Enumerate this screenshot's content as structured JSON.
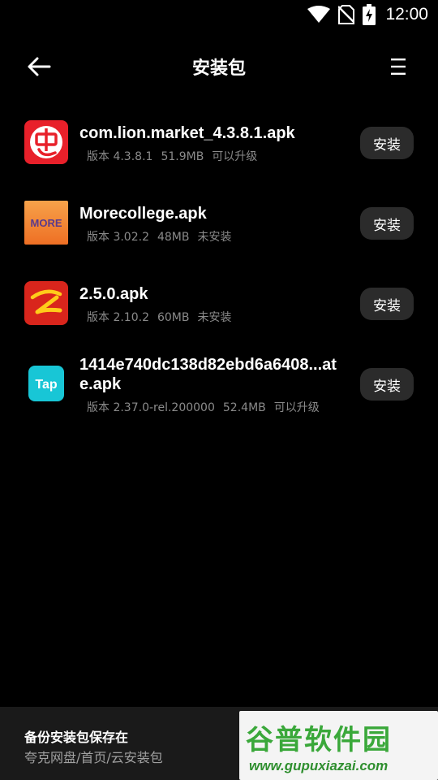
{
  "status_bar": {
    "time": "12:00"
  },
  "header": {
    "title": "安装包"
  },
  "packages": [
    {
      "name": "com.lion.market_4.3.8.1.apk",
      "version": "版本 4.3.8.1",
      "size": "51.9MB",
      "status": "可以升级",
      "install_label": "安装",
      "icon": "lion-market-icon"
    },
    {
      "name": "Morecollege.apk",
      "version": "版本 3.02.2",
      "size": "48MB",
      "status": "未安装",
      "install_label": "安装",
      "icon": "morecollege-icon",
      "icon_text": "MORE"
    },
    {
      "name": "2.5.0.apk",
      "version": "版本 2.10.2",
      "size": "60MB",
      "status": "未安装",
      "install_label": "安装",
      "icon": "red-app-icon"
    },
    {
      "name": "1414e740dc138d82ebd6a6408...ate.apk",
      "version": "版本 2.37.0-rel.200000",
      "size": "52.4MB",
      "status": "可以升级",
      "install_label": "安装",
      "icon": "taptap-icon",
      "icon_text": "Tap"
    }
  ],
  "footer": {
    "title": "备份安装包保存在",
    "path": "夸克网盘/首页/云安装包",
    "watermark_text": "谷普软件园",
    "watermark_url": "www.gupuxiazai.com"
  },
  "colors": {
    "background": "#000000",
    "button_bg": "#2b2b2b",
    "meta_text": "#8a8a8a",
    "footer_bg": "#1a1a1a"
  }
}
